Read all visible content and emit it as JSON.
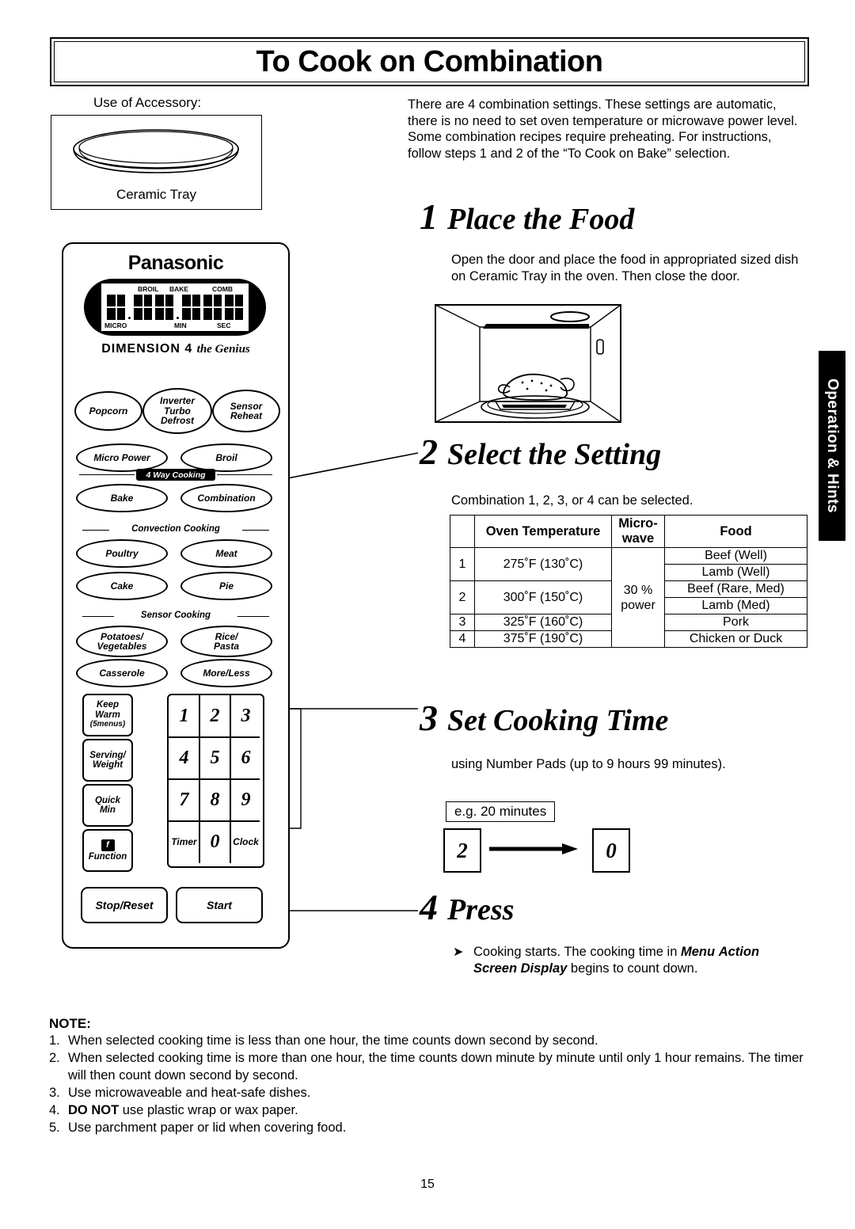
{
  "title": "To Cook on Combination",
  "accessory": {
    "label": "Use of Accessory:",
    "caption": "Ceramic Tray",
    "icon": "ceramic-tray-illustration"
  },
  "intro": "There are 4 combination settings. These settings are automatic, there is no need to set oven temperature or microwave power level. Some combination recipes require preheating. For instructions, follow steps 1 and 2 of the “To Cook on Bake” selection.",
  "steps": [
    {
      "num": "1",
      "label": "Place the Food",
      "text": "Open the door and place the food in appropriated sized dish on Ceramic Tray in the oven. Then close the door."
    },
    {
      "num": "2",
      "label": "Select the Setting",
      "text": "Combination 1, 2, 3, or 4 can be selected."
    },
    {
      "num": "3",
      "label": "Set Cooking Time",
      "text": "using Number Pads (up to 9 hours 99 minutes)."
    },
    {
      "num": "4",
      "label": "Press",
      "text": ""
    }
  ],
  "settings_table": {
    "headers": [
      "",
      "Oven Temperature",
      "Micro-wave",
      "Food"
    ],
    "header_micro_line1": "Micro-",
    "header_micro_line2": "wave",
    "microwave_power_line1": "30 %",
    "microwave_power_line2": "power",
    "rows": [
      {
        "no": "1",
        "temp": "275˚F (130˚C)",
        "food_line1": "Beef (Well)",
        "food_line2": "Lamb (Well)"
      },
      {
        "no": "2",
        "temp": "300˚F (150˚C)",
        "food_line1": "Beef (Rare, Med)",
        "food_line2": "Lamb (Med)"
      },
      {
        "no": "3",
        "temp": "325˚F (160˚C)",
        "food_line1": "Pork",
        "food_line2": ""
      },
      {
        "no": "4",
        "temp": "375˚F (190˚C)",
        "food_line1": "Chicken or Duck",
        "food_line2": ""
      }
    ]
  },
  "example": {
    "caption": "e.g. 20 minutes",
    "key_first": "2",
    "key_second": "0"
  },
  "press_note": {
    "bullet": "➤",
    "part1": "Cooking starts. The cooking time in ",
    "emphasis1": "Menu",
    "emphasis2": "Action Screen Display",
    "part2": " begins to count down."
  },
  "note": {
    "heading": "NOTE:",
    "items": [
      {
        "n": "1.",
        "text": "When selected cooking time is less than one hour, the time counts down second by second."
      },
      {
        "n": "2.",
        "text": "When selected cooking time is more than one hour, the time counts down minute by minute until only 1 hour remains. The timer will then count down second by second."
      },
      {
        "n": "3.",
        "text": "Use microwaveable and heat-safe dishes."
      },
      {
        "n": "4.",
        "bold": "DO NOT",
        "text": " use plastic wrap or wax paper."
      },
      {
        "n": "5.",
        "text": "Use parchment paper or lid when covering food."
      }
    ]
  },
  "page_number": "15",
  "side_tab": "Operation & Hints",
  "panel": {
    "brand": "Panasonic",
    "model": "DIMENSION 4",
    "model_sub": "the Genius",
    "display": {
      "top_labels": [
        "BROIL",
        "BAKE",
        "COMB"
      ],
      "bottom_labels": [
        "MICRO",
        "MIN",
        "SEC"
      ]
    },
    "group_labels": {
      "four_way": "4 Way Cooking",
      "convection": "Convection Cooking",
      "sensor": "Sensor Cooking"
    },
    "oval_buttons": [
      {
        "label": "Popcorn"
      },
      {
        "label": "Inverter\nTurbo\nDefrost"
      },
      {
        "label": "Sensor\nReheat"
      },
      {
        "label": "Micro Power"
      },
      {
        "label": "Broil"
      },
      {
        "label": "Bake"
      },
      {
        "label": "Combination"
      },
      {
        "label": "Poultry"
      },
      {
        "label": "Meat"
      },
      {
        "label": "Cake"
      },
      {
        "label": "Pie"
      },
      {
        "label": "Potatoes/\nVegetables"
      },
      {
        "label": "Rice/\nPasta"
      },
      {
        "label": "Casserole"
      },
      {
        "label": "More/Less"
      }
    ],
    "side_buttons": [
      {
        "line1": "Keep",
        "line2": "Warm",
        "line3": "(5menus)"
      },
      {
        "line1": "Serving/",
        "line2": "Weight",
        "line3": ""
      },
      {
        "line1": "Quick",
        "line2": "Min",
        "line3": ""
      },
      {
        "line1": "",
        "line2": "Function",
        "line3": ""
      }
    ],
    "number_pads": [
      "1",
      "2",
      "3",
      "4",
      "5",
      "6",
      "7",
      "8",
      "9",
      "Timer",
      "0",
      "Clock"
    ],
    "stop_label": "Stop/Reset",
    "start_label": "Start"
  }
}
